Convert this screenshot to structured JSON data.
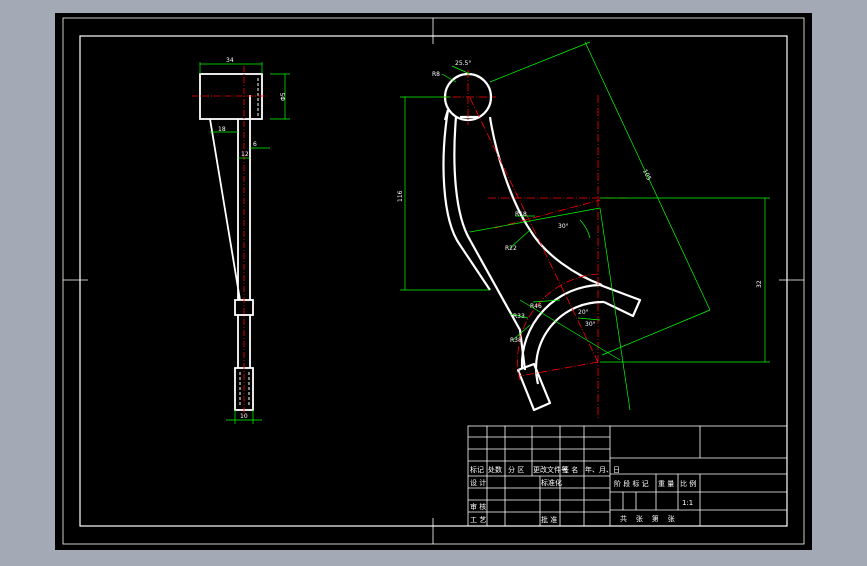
{
  "colors": {
    "app_bg": "#a3aab6",
    "paper": "#000000",
    "frame": "#ffffff",
    "outline": "#ffffff",
    "dimension": "#00ff00",
    "centerline": "#ff0000"
  },
  "drawing": {
    "dims_left": {
      "top_width": "34",
      "side_height": "Φ5",
      "inner_left": "18",
      "inner_small": "12",
      "right_small": "6",
      "bottom_width": "10"
    },
    "dims_right": {
      "top_radius": "R8",
      "top_angle": "25.5°",
      "left_height": "116",
      "diagonal": "105",
      "right_height": "32",
      "mid_angle": "30°",
      "mid_radius": "R18",
      "mid_radius_2": "R22",
      "arc_radius_1": "R46",
      "arc_radius_2": "R33",
      "arc_radius_3": "R38",
      "angle_20": "20°",
      "angle_30": "30°"
    }
  },
  "title_block": {
    "header_cells": [
      "标记",
      "处数",
      "分 区",
      "更改文件号",
      "签 名",
      "年、月、日"
    ],
    "row_design": "设 计",
    "row_standard": "标准化",
    "row_review": "审 核",
    "row_process": "工 艺",
    "row_approve": "批 准",
    "stage_marks": "阶 段 标 记",
    "weight": "重 量",
    "scale": "比 例",
    "scale_value": "1:1",
    "sheet_info": "共    张    第    张"
  }
}
